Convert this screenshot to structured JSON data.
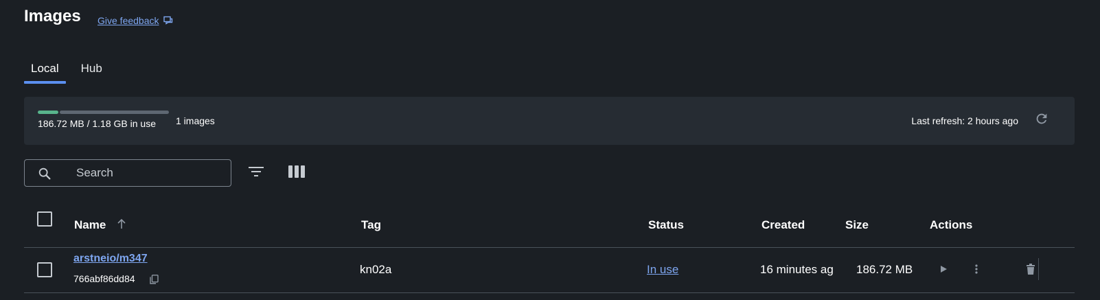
{
  "header": {
    "title": "Images",
    "feedback_label": "Give feedback",
    "feedback_icon": "feedback-icon"
  },
  "tabs": [
    {
      "label": "Local",
      "active": true
    },
    {
      "label": "Hub",
      "active": false
    }
  ],
  "usage": {
    "text": "186.72 MB / 1.18 GB in use",
    "used_fraction": 0.158,
    "images_count": "1 images",
    "last_refresh": "Last refresh: 2 hours ago",
    "refresh_icon": "refresh-icon"
  },
  "toolbar": {
    "search_placeholder": "Search",
    "search_icon": "search-icon",
    "filter_icon": "filter-icon",
    "columns_icon": "columns-icon"
  },
  "table": {
    "headers": {
      "name": "Name",
      "tag": "Tag",
      "status": "Status",
      "created": "Created",
      "size": "Size",
      "actions": "Actions"
    },
    "sort": {
      "column": "name",
      "direction": "ascending"
    },
    "rows": [
      {
        "name": "arstneio/m347",
        "id": "766abf86dd84",
        "tag": "kn02a",
        "status": "In use",
        "created": "16 minutes ag",
        "size": "186.72 MB",
        "actions": [
          "run-icon",
          "more-icon",
          "delete-icon"
        ]
      }
    ]
  },
  "colors": {
    "background": "#1b1f24",
    "panel": "#262c33",
    "accent": "#5b8ff0",
    "link": "#7ea6f0",
    "usage_used": "#58b48c",
    "usage_free": "#5e6772"
  }
}
